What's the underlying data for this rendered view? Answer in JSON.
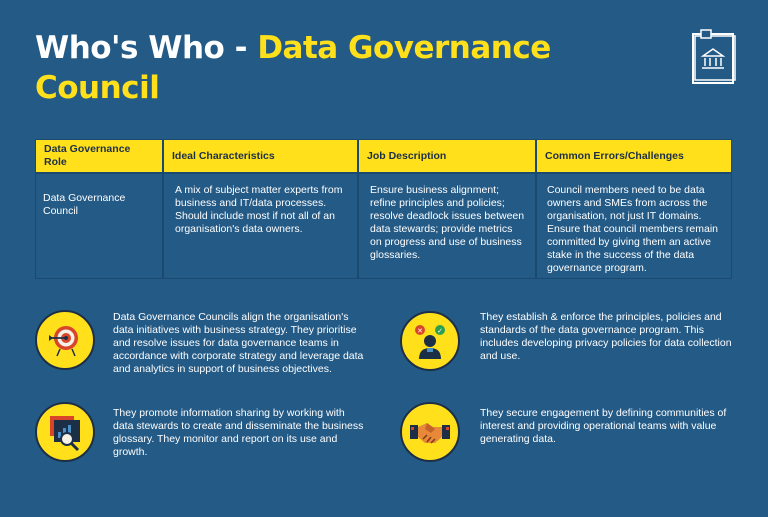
{
  "title": {
    "part1": "Who's Who - ",
    "part2": "Data Governance Council"
  },
  "logo": {
    "icon": "government-building-document-icon"
  },
  "table": {
    "headers": [
      "Data Governance Role",
      "Ideal Characteristics",
      "Job Description",
      "Common Errors/Challenges"
    ],
    "row": [
      "Data Governance Council",
      "A mix of subject matter experts from business and IT/data processes. Should include most if not all of an organisation's data owners.",
      "Ensure business alignment; refine principles and policies; resolve deadlock issues between data stewards; provide metrics on progress and use of business glossaries.",
      "Council members need to be data owners and SMEs from across the organisation, not just IT domains. Ensure that council members remain committed by giving them an active stake in the success of the data governance program."
    ]
  },
  "features": [
    {
      "icon": "target-arrow-icon",
      "text": "Data Governance Councils align the organisation's data initiatives with business strategy. They prioritise and resolve issues for data governance teams in accordance with corporate strategy and leverage data and analytics in support of business objectives."
    },
    {
      "icon": "decision-person-icon",
      "text": "They establish & enforce the principles, policies and standards of the data governance program. This includes developing privacy policies for data collection and use."
    },
    {
      "icon": "report-magnifier-icon",
      "text": "They promote information sharing by working with data stewards to create and disseminate the business glossary. They monitor and report on its use and growth."
    },
    {
      "icon": "handshake-icon",
      "text": "They secure engagement by defining communities of interest and providing operational teams with value generating data."
    }
  ],
  "colors": {
    "background": "#245a86",
    "accent": "#ffe01b",
    "dark": "#1d2f47"
  }
}
